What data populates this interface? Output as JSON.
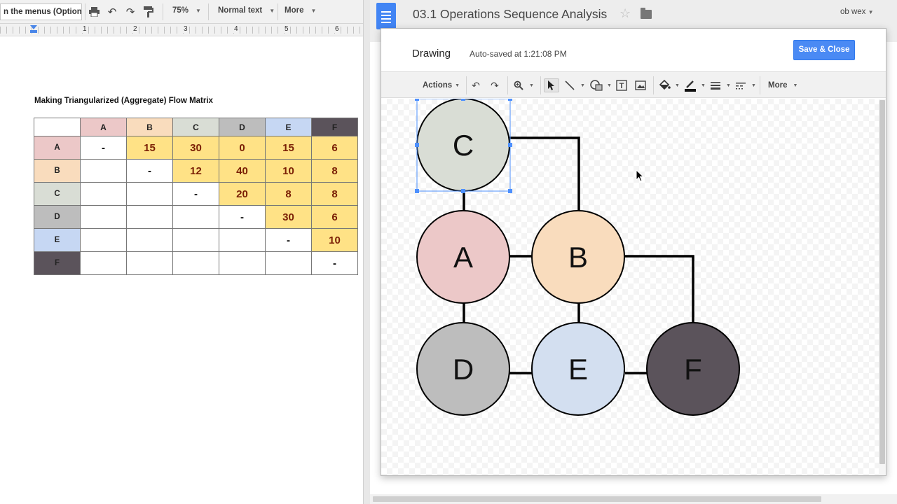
{
  "doc_toolbar": {
    "search_menus": "n the menus (Option+",
    "zoom": "75%",
    "style": "Normal text",
    "more": "More"
  },
  "ruler": {
    "marks": [
      "1",
      "2",
      "3",
      "4",
      "5",
      "6"
    ]
  },
  "doc": {
    "heading": "Making Triangularized (Aggregate) Flow Matrix"
  },
  "matrix": {
    "columns": [
      "A",
      "B",
      "C",
      "D",
      "E",
      "F"
    ],
    "rows": [
      {
        "label": "A",
        "cells": [
          "-",
          "15",
          "30",
          "0",
          "15",
          "6"
        ]
      },
      {
        "label": "B",
        "cells": [
          "",
          "-",
          "12",
          "40",
          "10",
          "8"
        ]
      },
      {
        "label": "C",
        "cells": [
          "",
          "",
          "-",
          "20",
          "8",
          "8"
        ]
      },
      {
        "label": "D",
        "cells": [
          "",
          "",
          "",
          "-",
          "30",
          "6"
        ]
      },
      {
        "label": "E",
        "cells": [
          "",
          "",
          "",
          "",
          "-",
          "10"
        ]
      },
      {
        "label": "F",
        "cells": [
          "",
          "",
          "",
          "",
          "",
          "-"
        ]
      }
    ],
    "colors": {
      "A": "#ecc8c8",
      "B": "#f9dcbd",
      "C": "#d9ddd5",
      "D": "#bdbdbd",
      "E": "#c6d7f3",
      "F": "#5b535b",
      "value": "#ffe286"
    }
  },
  "header": {
    "title": "03.1 Operations Sequence Analysis",
    "user": "ob wex"
  },
  "dialog": {
    "title": "Drawing",
    "status": "Auto-saved at 1:21:08 PM",
    "save_close": "Save & Close",
    "toolbar": {
      "actions": "Actions",
      "more": "More",
      "icons": [
        "undo-icon",
        "redo-icon",
        "zoom-icon",
        "select-icon",
        "line-icon",
        "shape-icon",
        "textbox-icon",
        "image-icon",
        "fill-color-icon",
        "line-color-icon",
        "line-weight-icon",
        "line-dash-icon"
      ]
    },
    "nodes": [
      "C",
      "A",
      "B",
      "D",
      "E",
      "F"
    ]
  }
}
